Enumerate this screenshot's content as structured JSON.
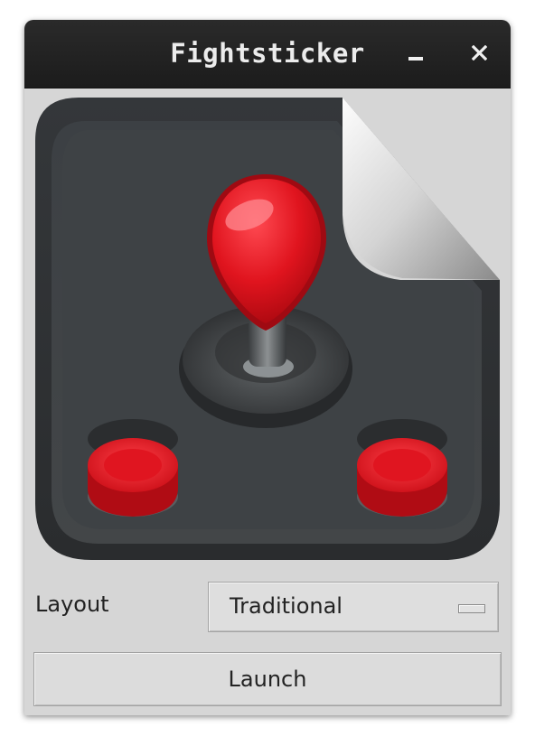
{
  "window": {
    "title": "Fightsticker",
    "minimize_icon": "minimize-icon",
    "close_icon": "close-icon"
  },
  "artwork": {
    "icon": "arcade-joystick-icon",
    "colors": {
      "base": "#3d4042",
      "ball_top": "#e0141e",
      "buttons": "#d01018",
      "page_curl": "#c8c8c8"
    }
  },
  "form": {
    "layout_label": "Layout",
    "layout_value": "Traditional",
    "launch_label": "Launch"
  }
}
